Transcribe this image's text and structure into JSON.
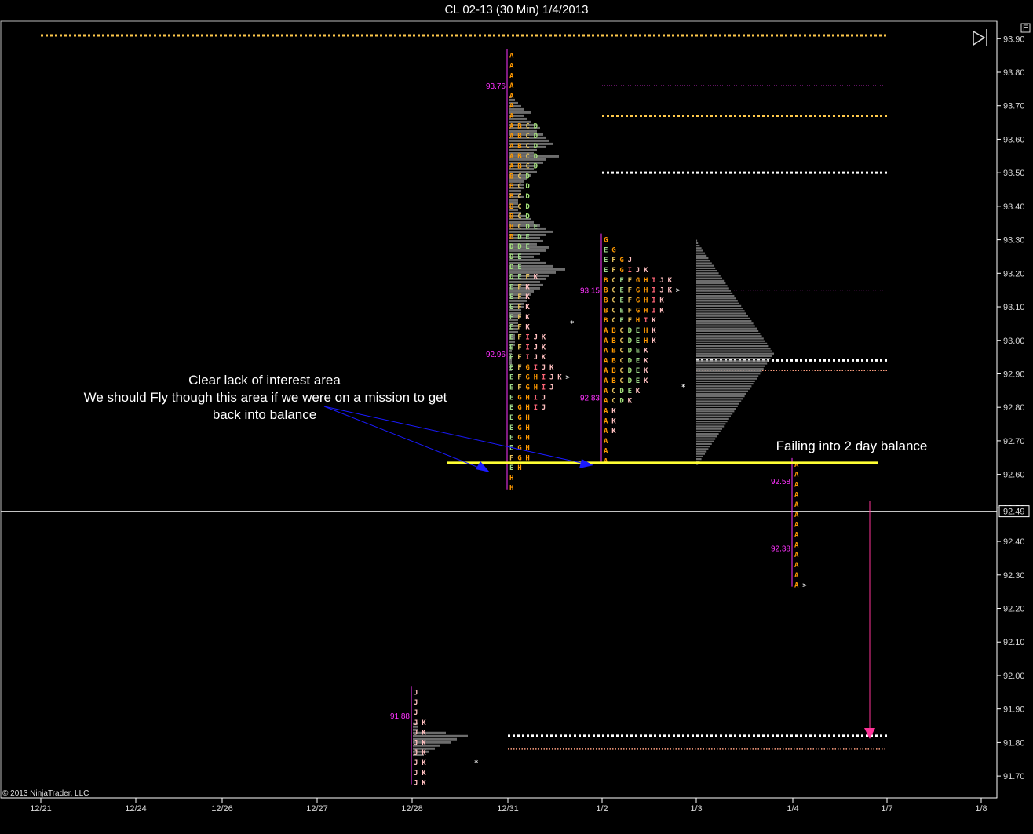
{
  "window": {
    "title": "CL 02-13 (30 Min)  1/4/2013"
  },
  "copyright": "© 2013 NinjaTrader, LLC",
  "panel_marker": "F",
  "current_price_label": "92.49",
  "colors": {
    "background": "#000000",
    "axis": "#ffffff",
    "yellow_dotted": "#ffc94a",
    "white_dotted": "#ffffff",
    "magenta": "#ff33ff",
    "salmon_dotted": "#ff9f80",
    "histogram": "#808080",
    "support_line": "#ffff33",
    "blue_arrow": "#1a1aff",
    "pink_arrow": "#ff3399"
  },
  "chart_data": {
    "type": "market-profile",
    "title": "CL 02-13 (30 Min)  1/4/2013",
    "x_tick_labels": [
      "12/21",
      "12/24",
      "12/26",
      "12/27",
      "12/28",
      "12/31",
      "1/2",
      "1/3",
      "1/4",
      "1/7",
      "1/8"
    ],
    "y_tick_labels": [
      "91.70",
      "91.80",
      "91.90",
      "92.00",
      "92.10",
      "92.20",
      "92.30",
      "92.40",
      "92.50",
      "92.60",
      "92.70",
      "92.80",
      "92.90",
      "93.00",
      "93.10",
      "93.20",
      "93.30",
      "93.40",
      "93.50",
      "93.60",
      "93.70",
      "93.80",
      "93.90"
    ],
    "ylim": [
      91.66,
      93.94
    ],
    "tick_size": 0.03,
    "current_price": 92.49,
    "profiles": [
      {
        "session": "12/28",
        "rows": [
          {
            "p": 91.95,
            "l": "J"
          },
          {
            "p": 91.92,
            "l": "J"
          },
          {
            "p": 91.89,
            "l": "J"
          },
          {
            "p": 91.86,
            "l": "J K"
          },
          {
            "p": 91.83,
            "l": "J K"
          },
          {
            "p": 91.8,
            "l": "J K"
          },
          {
            "p": 91.77,
            "l": "J K"
          },
          {
            "p": 91.74,
            "l": "J K"
          },
          {
            "p": 91.71,
            "l": "J K"
          },
          {
            "p": 91.68,
            "l": "J K"
          }
        ],
        "poc_label": "91.88",
        "poc_price": 91.88,
        "histogram": [
          1,
          1,
          1,
          6,
          10,
          8,
          7,
          5,
          4,
          3,
          2
        ],
        "histogram_top": 91.86
      },
      {
        "session": "12/31",
        "rows": [
          {
            "p": 93.85,
            "l": "A"
          },
          {
            "p": 93.82,
            "l": "A"
          },
          {
            "p": 93.79,
            "l": "A"
          },
          {
            "p": 93.76,
            "l": "A"
          },
          {
            "p": 93.73,
            "l": "A"
          },
          {
            "p": 93.7,
            "l": "A"
          },
          {
            "p": 93.67,
            "l": "A"
          },
          {
            "p": 93.64,
            "l": "A B C D"
          },
          {
            "p": 93.61,
            "l": "A B C D"
          },
          {
            "p": 93.58,
            "l": "A B C D"
          },
          {
            "p": 93.55,
            "l": "A B C D"
          },
          {
            "p": 93.52,
            "l": "A B C D"
          },
          {
            "p": 93.49,
            "l": "B C D"
          },
          {
            "p": 93.46,
            "l": "B C D"
          },
          {
            "p": 93.43,
            "l": "B C D"
          },
          {
            "p": 93.4,
            "l": "B C D"
          },
          {
            "p": 93.37,
            "l": "B C D"
          },
          {
            "p": 93.34,
            "l": "B C D E"
          },
          {
            "p": 93.31,
            "l": "B D E"
          },
          {
            "p": 93.28,
            "l": "D D E"
          },
          {
            "p": 93.25,
            "l": "D E"
          },
          {
            "p": 93.22,
            "l": "D E"
          },
          {
            "p": 93.19,
            "l": "D E F K"
          },
          {
            "p": 93.16,
            "l": "E F K"
          },
          {
            "p": 93.13,
            "l": "E F K"
          },
          {
            "p": 93.1,
            "l": "E F K"
          },
          {
            "p": 93.07,
            "l": "E F K"
          },
          {
            "p": 93.04,
            "l": "E F K"
          },
          {
            "p": 93.01,
            "l": "E F I J K"
          },
          {
            "p": 92.98,
            "l": "E F I J K"
          },
          {
            "p": 92.95,
            "l": "E F I J K"
          },
          {
            "p": 92.92,
            "l": "E F G I J K"
          },
          {
            "p": 92.89,
            "l": "E F G H I J K >"
          },
          {
            "p": 92.86,
            "l": "E F G H I J"
          },
          {
            "p": 92.83,
            "l": "E G H I J"
          },
          {
            "p": 92.8,
            "l": "E G H I J"
          },
          {
            "p": 92.77,
            "l": "E G H"
          },
          {
            "p": 92.74,
            "l": "E G H"
          },
          {
            "p": 92.71,
            "l": "E G H"
          },
          {
            "p": 92.68,
            "l": "E G H"
          },
          {
            "p": 92.65,
            "l": "F G H"
          },
          {
            "p": 92.62,
            "l": "E H"
          },
          {
            "p": 92.59,
            "l": "H"
          },
          {
            "p": 92.56,
            "l": "H"
          }
        ],
        "poc_labels": [
          {
            "text": "93.76",
            "price": 93.76
          },
          {
            "text": "92.96",
            "price": 92.96
          }
        ],
        "histogram": [
          1,
          2,
          3,
          4,
          5,
          7,
          5,
          6,
          7,
          9,
          10,
          9,
          11,
          12,
          13,
          14,
          12,
          9,
          8,
          16,
          12,
          11,
          9,
          8,
          9,
          7,
          6,
          5,
          5,
          5,
          4,
          4,
          5,
          3,
          3,
          3,
          3,
          4,
          6,
          7,
          8,
          10,
          12,
          14,
          12,
          10,
          11,
          9,
          13,
          12,
          10,
          8,
          10,
          12,
          14,
          18,
          15,
          13,
          12,
          10,
          11,
          10,
          8,
          7,
          6,
          6,
          5,
          5,
          4,
          4,
          4,
          3,
          3,
          3,
          3,
          3,
          2,
          2,
          2,
          2,
          1,
          1,
          1,
          1,
          1,
          1,
          1,
          1
        ],
        "histogram_top": 93.73
      },
      {
        "session": "1/2",
        "rows": [
          {
            "p": 93.3,
            "l": "G"
          },
          {
            "p": 93.27,
            "l": "E G"
          },
          {
            "p": 93.24,
            "l": "E F G J"
          },
          {
            "p": 93.21,
            "l": "E F G I J K"
          },
          {
            "p": 93.18,
            "l": "B C E F G H I J K"
          },
          {
            "p": 93.15,
            "l": "B C E F G H I J K >"
          },
          {
            "p": 93.12,
            "l": "B C E F G H I K"
          },
          {
            "p": 93.09,
            "l": "B C E F G H I K"
          },
          {
            "p": 93.06,
            "l": "B C E F H I K"
          },
          {
            "p": 93.03,
            "l": "A B C D E H K"
          },
          {
            "p": 93.0,
            "l": "A B C D E H K"
          },
          {
            "p": 92.97,
            "l": "A B C D E K"
          },
          {
            "p": 92.94,
            "l": "A B C D E K"
          },
          {
            "p": 92.91,
            "l": "A B C D E K"
          },
          {
            "p": 92.88,
            "l": "A B C D E K"
          },
          {
            "p": 92.85,
            "l": "A C D E K"
          },
          {
            "p": 92.82,
            "l": "A C D K"
          },
          {
            "p": 92.79,
            "l": "A K"
          },
          {
            "p": 92.76,
            "l": "A K"
          },
          {
            "p": 92.73,
            "l": "A K"
          },
          {
            "p": 92.7,
            "l": "A"
          },
          {
            "p": 92.67,
            "l": "A"
          },
          {
            "p": 92.64,
            "l": "A"
          }
        ],
        "poc_labels": [
          {
            "text": "93.15",
            "price": 93.15
          },
          {
            "text": "92.83",
            "price": 92.83
          }
        ],
        "histogram": [
          1,
          2,
          4,
          6,
          8,
          10,
          12,
          14,
          16,
          18,
          20,
          22,
          24,
          26,
          28,
          30,
          32,
          34,
          36,
          38,
          40,
          42,
          44,
          46,
          48,
          50,
          52,
          54,
          56,
          58,
          60,
          62,
          64,
          66,
          68,
          70,
          72,
          74,
          76,
          78,
          80,
          82,
          84,
          86,
          88,
          90,
          88,
          86,
          84,
          82,
          80,
          78,
          76,
          74,
          72,
          70,
          68,
          66,
          64,
          62,
          60,
          58,
          56,
          54,
          52,
          50,
          48,
          46,
          44,
          42,
          40,
          38,
          36,
          34,
          32,
          30,
          28,
          26,
          24,
          22,
          20,
          18,
          16,
          14,
          12,
          10,
          8,
          6,
          4,
          2
        ],
        "histogram_top": 93.3
      },
      {
        "session": "1/4",
        "rows": [
          {
            "p": 92.63,
            "l": "A"
          },
          {
            "p": 92.6,
            "l": "A"
          },
          {
            "p": 92.57,
            "l": "A"
          },
          {
            "p": 92.54,
            "l": "A"
          },
          {
            "p": 92.51,
            "l": "A"
          },
          {
            "p": 92.48,
            "l": "A"
          },
          {
            "p": 92.45,
            "l": "A"
          },
          {
            "p": 92.42,
            "l": "A"
          },
          {
            "p": 92.39,
            "l": "A"
          },
          {
            "p": 92.36,
            "l": "A"
          },
          {
            "p": 92.33,
            "l": "A"
          },
          {
            "p": 92.3,
            "l": "A"
          },
          {
            "p": 92.27,
            "l": "A >"
          }
        ],
        "poc_labels": [
          {
            "text": "92.58",
            "price": 92.58
          },
          {
            "text": "92.38",
            "price": 92.38
          }
        ]
      }
    ],
    "levels": [
      {
        "price": 93.91,
        "style": "yellow_dotted",
        "x_from": "12/21",
        "x_to": "1/7"
      },
      {
        "price": 93.76,
        "style": "magenta_dotted",
        "x_from": "1/2",
        "x_to": "1/7"
      },
      {
        "price": 93.67,
        "style": "yellow_dotted",
        "x_from": "1/2",
        "x_to": "1/7"
      },
      {
        "price": 93.5,
        "style": "white_dotted",
        "x_from": "1/2",
        "x_to": "1/7"
      },
      {
        "price": 93.15,
        "style": "magenta_dotted",
        "x_from": "1/3",
        "x_to": "1/7"
      },
      {
        "price": 92.94,
        "style": "white_dotted",
        "x_from": "1/3",
        "x_to": "1/7"
      },
      {
        "price": 92.91,
        "style": "salmon_dotted",
        "x_from": "1/3",
        "x_to": "1/7"
      },
      {
        "price": 91.82,
        "style": "white_dotted",
        "x_from": "12/31",
        "x_to": "1/7"
      },
      {
        "price": 91.78,
        "style": "salmon_dotted",
        "x_from": "12/31",
        "x_to": "1/7"
      }
    ],
    "support_line_price": 92.63
  },
  "annotations": {
    "lack_of_interest": [
      "Clear lack of interest area",
      "We should Fly though this area if we were on a mission to get",
      "back into balance"
    ],
    "two_day_balance": "Failing into 2 day balance"
  }
}
